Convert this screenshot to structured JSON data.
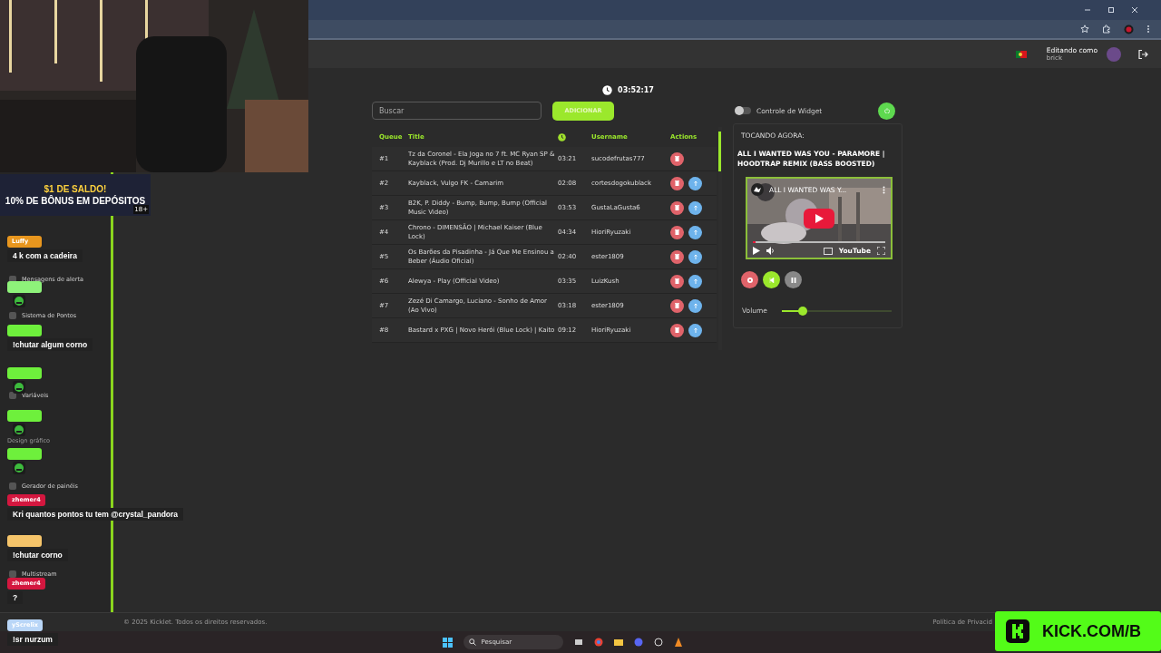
{
  "header": {
    "editing_label": "Editando como",
    "username": "brick"
  },
  "sidebar": {
    "items": [
      {
        "label": "Mensagens de alerta",
        "kind": "item"
      },
      {
        "label": "Sistema de Pontos",
        "kind": "item"
      },
      {
        "label": "Variáveis",
        "kind": "item"
      },
      {
        "label": "Design gráfico",
        "kind": "section"
      },
      {
        "label": "Gerador de painéis",
        "kind": "item"
      },
      {
        "label": "Multistream",
        "kind": "item"
      }
    ]
  },
  "clock": "03:52:17",
  "search": {
    "placeholder": "Buscar"
  },
  "add_button": "ADICIONAR",
  "table": {
    "columns": [
      "Queue",
      "Title",
      "Username",
      "Actions"
    ],
    "rows": [
      {
        "queue": "#1",
        "title": "Tz da Coronel - Ela Joga no 7 ft. MC Ryan SP & Kayblack (Prod. Dj Murillo e LT no Beat)",
        "duration": "03:21",
        "username": "sucodefrutas777",
        "can_move_up": false
      },
      {
        "queue": "#2",
        "title": "Kayblack, Vulgo FK - Camarim",
        "duration": "02:08",
        "username": "cortesdogokublack",
        "can_move_up": true
      },
      {
        "queue": "#3",
        "title": "B2K, P. Diddy - Bump, Bump, Bump (Official Music Video)",
        "duration": "03:53",
        "username": "GustaLaGusta6",
        "can_move_up": true
      },
      {
        "queue": "#4",
        "title": "Chrono - DIMENSÃO | Michael Kaiser (Blue Lock)",
        "duration": "04:34",
        "username": "HioriRyuzaki",
        "can_move_up": true
      },
      {
        "queue": "#5",
        "title": "Os Barões da Pisadinha - Já Que Me Ensinou a Beber (Áudio Oficial)",
        "duration": "02:40",
        "username": "ester1809",
        "can_move_up": true
      },
      {
        "queue": "#6",
        "title": "Alewya - Play (Official Video)",
        "duration": "03:35",
        "username": "LuizKush",
        "can_move_up": true
      },
      {
        "queue": "#7",
        "title": "Zezé Di Camargo, Luciano - Sonho de Amor (Ao Vivo)",
        "duration": "03:18",
        "username": "ester1809",
        "can_move_up": true
      },
      {
        "queue": "#8",
        "title": "Bastard x PXG | Novo Herói (Blue Lock) | Kaito",
        "duration": "09:12",
        "username": "HioriRyuzaki",
        "can_move_up": true
      }
    ]
  },
  "widget_control": {
    "label": "Controle de Widget",
    "on": false
  },
  "now_playing": {
    "heading": "TOCANDO AGORA:",
    "title": "ALL I WANTED WAS YOU - PARAMORE | HOODTRAP REMIX (BASS BOOSTED)",
    "video_title": "ALL I WANTED WAS Y...",
    "player_logo": "YouTube",
    "video_progress": {
      "level": 0.02
    },
    "volume_label": "Volume",
    "volume": {
      "level": 0.19
    }
  },
  "footer": {
    "copyright": "© 2025 Kicklet. Todos os direitos reservados.",
    "privacy_link": "Política de Privacid"
  },
  "ad_banner": {
    "line_1": "$1 DE SALDO!",
    "line_2": "10% DE BÔNUS EM DEPÓSITOS",
    "age_badge": "18+"
  },
  "chat": [
    {
      "user": "Luffy",
      "color": "#e8961e",
      "message": "4 k com a cadeira",
      "kind": "text"
    },
    {
      "color": "#8ef27a",
      "kind": "emote"
    },
    {
      "color": "#6ef03c",
      "message": "!chutar algum corno",
      "kind": "text"
    },
    {
      "color": "#6ef03c",
      "kind": "emote"
    },
    {
      "color": "#6ef03c",
      "kind": "emote"
    },
    {
      "color": "#6ef03c",
      "kind": "emote"
    },
    {
      "user": "zhemer4",
      "color": "#d4173f",
      "message": "Kri quantos pontos tu tem @crystal_pandora",
      "kind": "text"
    },
    {
      "color": "#f5c46a",
      "message": "!chutar corno",
      "kind": "text"
    },
    {
      "user": "zhemer4",
      "color": "#d4173f",
      "message": "?",
      "kind": "text"
    },
    {
      "user": "yScrelix",
      "color": "#b9d6f7",
      "message": "!sr nurzum",
      "kind": "text"
    }
  ],
  "taskbar": {
    "search_placeholder": "Pesquisar"
  },
  "kick_banner": {
    "text": "KICK.COM/B"
  }
}
